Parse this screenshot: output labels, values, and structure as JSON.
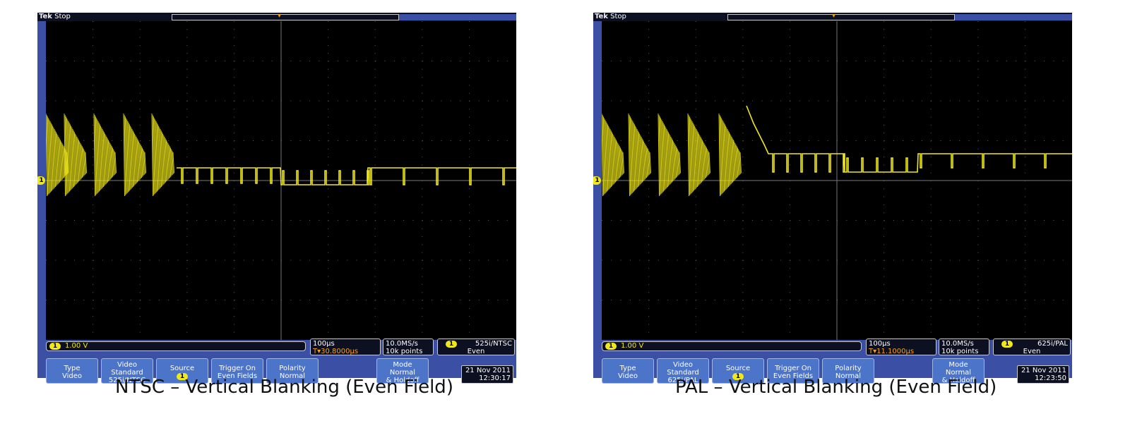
{
  "scopes": [
    {
      "brand_tek": "Tek",
      "status": "Stop",
      "trigger_marker": "T",
      "channel_marker": "1",
      "vertical_scale": "1.00 V",
      "channel_badge": "1",
      "timebase": "100µs",
      "trigger_delay": "▾30.8000µs",
      "sample_rate": "10.0MS/s",
      "record_length": "10k points",
      "trigger_standard": "525i/NTSC",
      "trigger_field": "Even",
      "menu": {
        "type_label": "Type",
        "type_value": "Video",
        "standard_label": "Video Standard",
        "standard_value": "525i/NTSC",
        "source_label": "Source",
        "source_value": "1",
        "trigger_on_label": "Trigger On",
        "trigger_on_value": "Even Fields",
        "polarity_label": "Polarity",
        "polarity_value": "Normal",
        "mode_label": "Mode",
        "mode_value1": "Normal",
        "mode_value2": "& Holdoff"
      },
      "date": "21 Nov 2011",
      "time": "12:30:17",
      "caption": "NTSC – Vertical Blanking (Even Field)"
    },
    {
      "brand_tek": "Tek",
      "status": "Stop",
      "trigger_marker": "T",
      "channel_marker": "1",
      "vertical_scale": "1.00 V",
      "channel_badge": "1",
      "timebase": "100µs",
      "trigger_delay": "▾11.1000µs",
      "sample_rate": "10.0MS/s",
      "record_length": "10k points",
      "trigger_standard": "625i/PAL",
      "trigger_field": "Even",
      "menu": {
        "type_label": "Type",
        "type_value": "Video",
        "standard_label": "Video Standard",
        "standard_value": "625i/PAL",
        "source_label": "Source",
        "source_value": "1",
        "trigger_on_label": "Trigger On",
        "trigger_on_value": "Even Fields",
        "polarity_label": "Polarity",
        "polarity_value": "Normal",
        "mode_label": "Mode",
        "mode_value1": "Normal",
        "mode_value2": "& Holdoff"
      },
      "date": "21 Nov 2011",
      "time": "12:23:50",
      "caption": "PAL – Vertical Blanking (Even Field)"
    }
  ],
  "colors": {
    "trace": "#f0e81a",
    "bezel": "#3b4fa4",
    "screen": "#000000",
    "accent": "#f5a21f"
  }
}
